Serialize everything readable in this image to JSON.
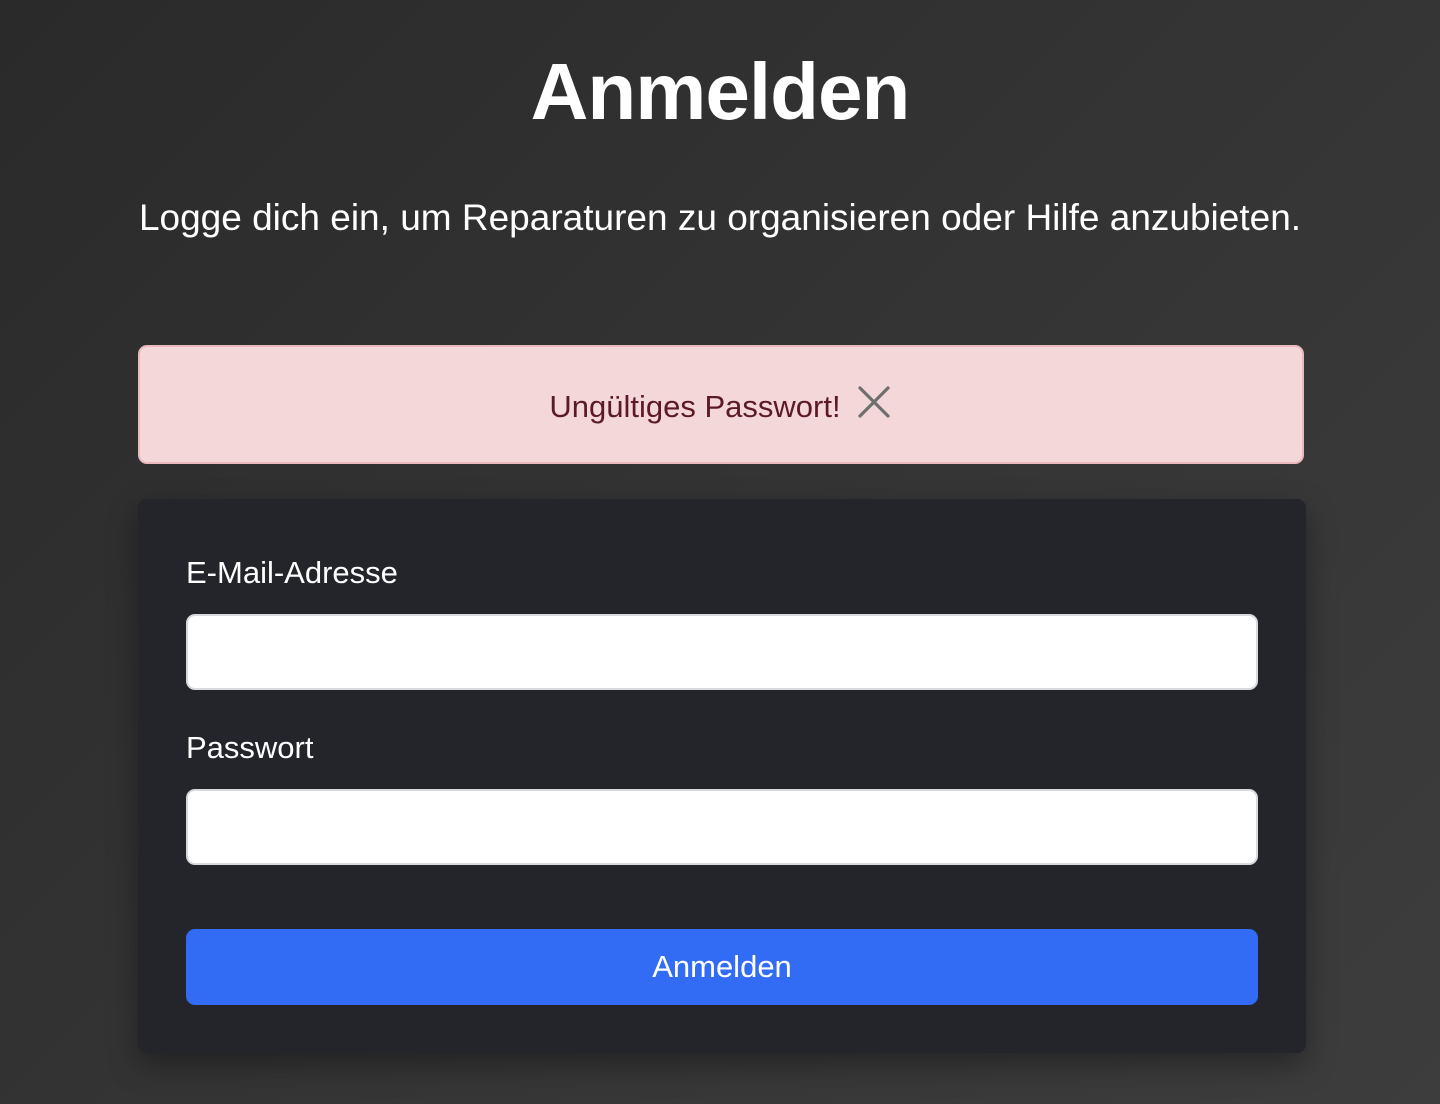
{
  "page": {
    "title": "Anmelden",
    "subtitle": "Logge dich ein, um Reparaturen zu organisieren oder Hilfe anzubieten."
  },
  "alert": {
    "message": "Ungültiges Passwort!",
    "close_icon": "close-icon",
    "background_color": "#f3d7d9",
    "text_color": "#5c1a22"
  },
  "form": {
    "email": {
      "label": "E-Mail-Adresse",
      "value": "",
      "placeholder": ""
    },
    "password": {
      "label": "Passwort",
      "value": "",
      "placeholder": ""
    },
    "submit_label": "Anmelden",
    "submit_color": "#326cf4"
  }
}
